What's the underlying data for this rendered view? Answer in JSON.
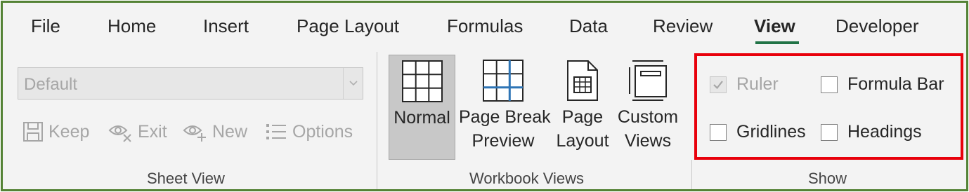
{
  "tabs": [
    {
      "label": "File",
      "active": false
    },
    {
      "label": "Home",
      "active": false
    },
    {
      "label": "Insert",
      "active": false
    },
    {
      "label": "Page Layout",
      "active": false
    },
    {
      "label": "Formulas",
      "active": false
    },
    {
      "label": "Data",
      "active": false
    },
    {
      "label": "Review",
      "active": false
    },
    {
      "label": "View",
      "active": true
    },
    {
      "label": "Developer",
      "active": false
    }
  ],
  "sheet_view": {
    "combo_value": "Default",
    "keep_label": "Keep",
    "exit_label": "Exit",
    "new_label": "New",
    "options_label": "Options",
    "group_label": "Sheet View"
  },
  "workbook_views": {
    "normal_label": "Normal",
    "page_break_line1": "Page Break",
    "page_break_line2": "Preview",
    "page_layout_line1": "Page",
    "page_layout_line2": "Layout",
    "custom_views_line1": "Custom",
    "custom_views_line2": "Views",
    "group_label": "Workbook Views"
  },
  "show": {
    "ruler": {
      "label": "Ruler",
      "checked": true,
      "disabled": true
    },
    "formula_bar": {
      "label": "Formula Bar",
      "checked": false,
      "disabled": false
    },
    "gridlines": {
      "label": "Gridlines",
      "checked": false,
      "disabled": false
    },
    "headings": {
      "label": "Headings",
      "checked": false,
      "disabled": false
    },
    "group_label": "Show"
  },
  "colors": {
    "accent_green": "#217346",
    "frame_green": "#548235",
    "highlight_red": "#e8000b"
  }
}
